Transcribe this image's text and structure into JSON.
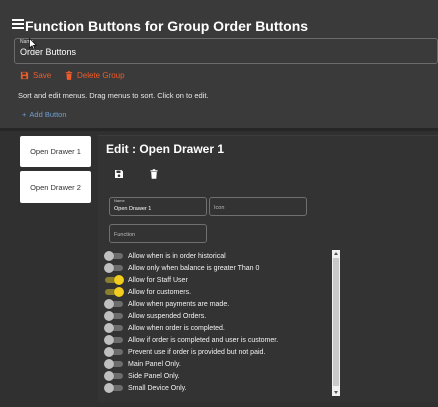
{
  "header": {
    "title": "Function Buttons for Group Order Buttons"
  },
  "group_name": {
    "label": "Name",
    "value": "Order Buttons"
  },
  "actions": {
    "save": "Save",
    "delete": "Delete Group"
  },
  "hint": "Sort and edit menus. Drag menus to sort. Click on to edit.",
  "add_button": "Add Button",
  "menus": [
    "Open Drawer 1",
    "Open Drawer 2"
  ],
  "editor": {
    "title": "Edit : Open Drawer 1",
    "name_label": "Name",
    "name_value": "Open Drawer 1",
    "icon_placeholder": "Icon",
    "function_placeholder": "Function"
  },
  "options": [
    {
      "label": "Allow when is in order historical",
      "on": false
    },
    {
      "label": "Allow only when balance is greater Than 0",
      "on": false
    },
    {
      "label": "Allow for Staff User",
      "on": true
    },
    {
      "label": "Allow for customers.",
      "on": true
    },
    {
      "label": "Allow when payments are made.",
      "on": false
    },
    {
      "label": "Allow suspended Orders.",
      "on": false
    },
    {
      "label": "Allow when order is completed.",
      "on": false
    },
    {
      "label": "Allow if order is completed and user is customer.",
      "on": false
    },
    {
      "label": "Prevent use if order is provided but not paid.",
      "on": false
    },
    {
      "label": "Main Panel Only.",
      "on": false
    },
    {
      "label": "Side Panel Only.",
      "on": false
    },
    {
      "label": "Small Device Only.",
      "on": false
    }
  ],
  "colors": {
    "accent": "#f05a28",
    "link": "#6f9fd0",
    "toggle_on": "#f2cc1f"
  }
}
